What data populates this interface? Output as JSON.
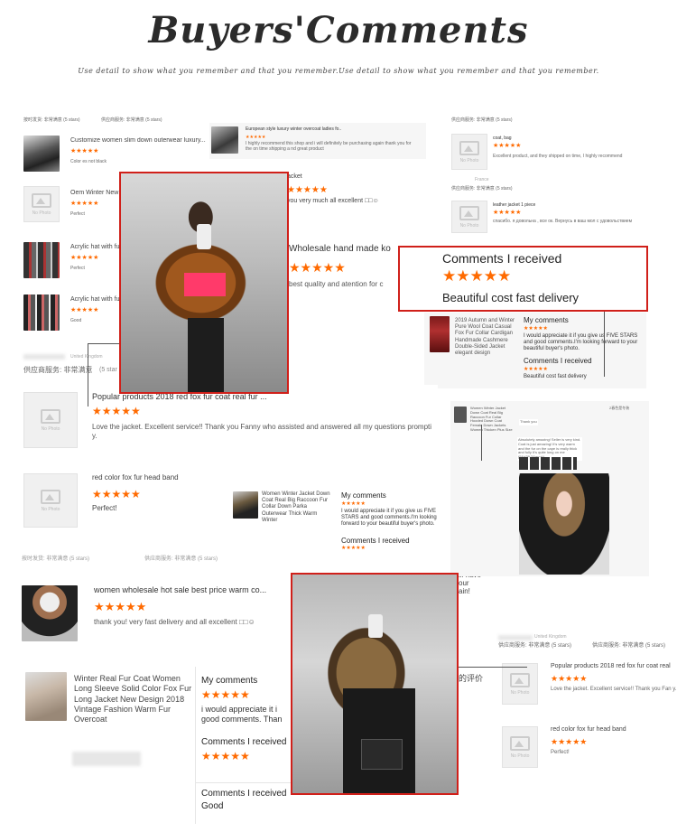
{
  "header": {
    "title": "Buyers'Comments",
    "subtitle": "Use detail to show what you remember and that you remember.Use detail to show what you remember and that you remember."
  },
  "colors": {
    "accent_red": "#d0201a",
    "star_orange": "#ff6a00"
  },
  "icons": {
    "star": "★",
    "no_photo": "image-placeholder-icon"
  },
  "stars5": "★★★★★",
  "no_photo_label": "No Photo",
  "service_bar": {
    "left": "按时发货: 非常满意 (5 stars)",
    "right": "供应商服务: 非常满意 (5 stars)",
    "right2": "供应商服务: 非常满意 (5 stars)",
    "left_b": "按时发货: 非常满意",
    "left_b_stars": "(5 stars)"
  },
  "col1_reviews": [
    {
      "title": "Customize women slim down outerwear luxury...",
      "comment": "Color es not black"
    },
    {
      "title": "Oem Winter New Do",
      "comment": "Perfect"
    },
    {
      "title": "Acrylic hat with fur po",
      "comment": "Perfect"
    },
    {
      "title": "Acrylic hat with fur po",
      "comment": "Good"
    }
  ],
  "col2_top": {
    "title": "European style luxury winter overcoat ladies fo..",
    "comment": "I highly recommend this shop and i will definitely be purchasing again thank you for the on time shipping a nd great product",
    "partial_a": "acket",
    "partial_b": "you very much all excellent □□☺"
  },
  "col3_top": [
    {
      "title": "coat, bag",
      "comment": "Excellent product, and they shipped on time, I highly recommend"
    },
    {
      "title": "leather jacket 1 piece",
      "comment": "спасибо. я довольна , все ок. Вернусь в ваш мол с удовольствием"
    }
  ],
  "col3_country": "France",
  "wholesale": {
    "title": "Wholesale hand made ko",
    "comment": "best quality and atention for c"
  },
  "comments_box": {
    "title": "Comments I received",
    "comment": "Beautiful cost fast delivery"
  },
  "uk_row": {
    "country": "United Kingdom",
    "service": "供应商服务: 非常满意",
    "stars": "(5 star"
  },
  "popular": {
    "title": "Popular products 2018 red fox fur coat real fur ...",
    "comment": "Love the jacket. Excellent service!! Thank you Fanny who assisted and answered all my questions prompti y."
  },
  "red_fox_band": {
    "title": "red color fox fur head band",
    "comment": "Perfect!"
  },
  "autumn_card": {
    "product": "2019 Autumn and Winter Pure Wool Coat Casual Fox Fur Collar Cardigan Handmade Cashmere Double-Sided Jacket elegant design",
    "my_comments": "My comments",
    "my_comment_text": "I would appreciate it if you give us FIVE STARS and good comments.I'm looking forward to your beautiful buyer's photo.",
    "received": "Comments I received",
    "received_text": "Beautiful cost fast delivery"
  },
  "chat_card": {
    "product": "Women Winter Jacket Down Coat Real Big Raccoon Fur Collar Hooded Down Coat Female Down Jackets Women Thicken Plus Size",
    "meta": "2春色是冬装",
    "bubble1": "Thank you",
    "bubble2": "Absolutely amazing! Seller is very kind. Coat is just amazing! It's very warm and the fur on the cape is really thick and fully It's quite long on me (5&#39;3&quot;)..."
  },
  "women_winter_card": {
    "product": "Women Winter Jacket Down Coat Real Big Raccoon Fur Collar Down Parka Outerwear Thick Warm Winter",
    "my_comments": "My comments",
    "my_comment_text": "I would appreciate it if you give us FIVE STARS and good comments.I'm looking forward to your beautiful buyer's photo.",
    "received": "Comments I received"
  },
  "service_row2": {
    "left": "按时发货: 非常满意 (5 stars)",
    "right": "供应商服务: 非常满意 (5 stars)"
  },
  "wholesale_hot": {
    "title": "women wholesale hot sale best price warm co...",
    "comment": "thank you! very fast delivery  and  all excellent □□☺"
  },
  "partial_right": {
    "line1": "ill have",
    "line2": "our",
    "line3": "ain!"
  },
  "fur_coat_card": {
    "product": "Winter Real Fur Coat Women Long Sleeve Solid Color Fox Fur Long Jacket New Design 2018 Vintage Fashion Warm Fur Overcoat",
    "my_comments": "My comments",
    "my_comment_text": "i would appreciate it i good comments. Than",
    "received": "Comments I received",
    "received2": "Comments I received",
    "received2_text": "Good",
    "cn_label": "的评价"
  },
  "right_bottom": {
    "country": "United Kingdom",
    "service": "供应商服务: 非常满意 (5 stars)",
    "service2": "供应商服务: 非常满意 (5 stars)",
    "popular_title": "Popular products 2018 red fox fur coat real",
    "popular_comment": "Love the jacket. Excellent service!! Thank you Fan y.",
    "band_title": "red color fox fur head band",
    "band_comment": "Perfect!"
  }
}
